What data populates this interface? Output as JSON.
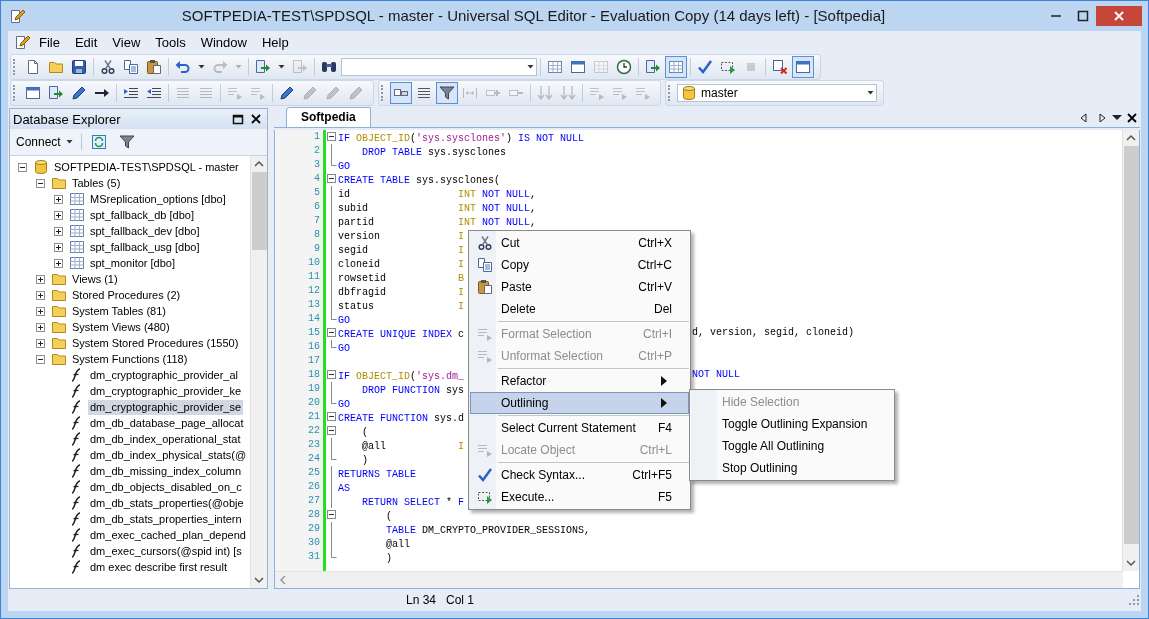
{
  "window": {
    "title": "SOFTPEDIA-TEST\\SPDSQL - master - Universal SQL Editor - Evaluation Copy (14 days left) - [Softpedia]"
  },
  "menu": [
    "File",
    "Edit",
    "View",
    "Tools",
    "Window",
    "Help"
  ],
  "toolbar_rows": [
    [
      {
        "groups": [
          [
            {
              "kind": "button",
              "disabled": false,
              "pressed": false
            },
            {
              "kind": "button",
              "disabled": false,
              "pressed": false
            },
            {
              "kind": "button",
              "disabled": false,
              "pressed": false
            }
          ],
          [
            {
              "kind": "button",
              "disabled": false,
              "pressed": false
            },
            {
              "kind": "button",
              "disabled": false,
              "pressed": false
            },
            {
              "kind": "button",
              "disabled": false,
              "pressed": false
            }
          ],
          [
            {
              "kind": "button",
              "disabled": false,
              "pressed": false
            },
            {
              "kind": "button",
              "disabled": false,
              "pressed": false
            },
            {
              "kind": "button",
              "disabled": true,
              "pressed": false
            },
            {
              "kind": "button",
              "disabled": true,
              "pressed": false
            }
          ],
          [
            {
              "kind": "button",
              "disabled": false,
              "pressed": false
            },
            {
              "kind": "button",
              "disabled": false,
              "pressed": false
            },
            {
              "kind": "button",
              "disabled": true,
              "pressed": false
            }
          ],
          [
            {
              "kind": "button",
              "disabled": false,
              "pressed": false
            },
            {
              "kind": "combo"
            }
          ],
          [
            {
              "kind": "button",
              "disabled": false,
              "pressed": false
            },
            {
              "kind": "button",
              "disabled": false,
              "pressed": false
            },
            {
              "kind": "button",
              "disabled": true,
              "pressed": false
            },
            {
              "kind": "button",
              "disabled": false,
              "pressed": false
            }
          ],
          [
            {
              "kind": "button",
              "disabled": false,
              "pressed": false
            },
            {
              "kind": "button",
              "disabled": false,
              "pressed": true
            }
          ],
          [
            {
              "kind": "button",
              "disabled": false,
              "pressed": false
            },
            {
              "kind": "button",
              "disabled": false,
              "pressed": false
            },
            {
              "kind": "button",
              "disabled": true,
              "pressed": false
            }
          ],
          [
            {
              "kind": "button",
              "disabled": false,
              "pressed": false
            },
            {
              "kind": "button",
              "disabled": false,
              "pressed": true
            }
          ]
        ]
      }
    ],
    [
      {
        "groups": [
          [
            {
              "kind": "button",
              "disabled": false,
              "pressed": false
            },
            {
              "kind": "button",
              "disabled": false,
              "pressed": false
            },
            {
              "kind": "button",
              "disabled": false,
              "pressed": false
            },
            {
              "kind": "button",
              "disabled": false,
              "pressed": false
            }
          ],
          [
            {
              "kind": "button",
              "disabled": false,
              "pressed": false
            },
            {
              "kind": "button",
              "disabled": false,
              "pressed": false
            }
          ],
          [
            {
              "kind": "button",
              "disabled": true,
              "pressed": false
            },
            {
              "kind": "button",
              "disabled": true,
              "pressed": false
            }
          ],
          [
            {
              "kind": "button",
              "disabled": true,
              "pressed": false
            },
            {
              "kind": "button",
              "disabled": true,
              "pressed": false
            }
          ],
          [
            {
              "kind": "button",
              "disabled": false,
              "pressed": false
            },
            {
              "kind": "button",
              "disabled": true,
              "pressed": false
            },
            {
              "kind": "button",
              "disabled": true,
              "pressed": false
            },
            {
              "kind": "button",
              "disabled": true,
              "pressed": false
            }
          ]
        ]
      },
      {
        "groups": [
          [
            {
              "kind": "button",
              "disabled": false,
              "pressed": true
            },
            {
              "kind": "button",
              "disabled": false,
              "pressed": false
            },
            {
              "kind": "button",
              "disabled": false,
              "pressed": true
            },
            {
              "kind": "button",
              "disabled": true,
              "pressed": false
            },
            {
              "kind": "button",
              "disabled": true,
              "pressed": false
            },
            {
              "kind": "button",
              "disabled": true,
              "pressed": false
            }
          ],
          [
            {
              "kind": "button",
              "disabled": true,
              "pressed": false
            },
            {
              "kind": "button",
              "disabled": true,
              "pressed": false
            }
          ],
          [
            {
              "kind": "button",
              "disabled": true,
              "pressed": false
            },
            {
              "kind": "button",
              "disabled": true,
              "pressed": false
            },
            {
              "kind": "button",
              "disabled": true,
              "pressed": false
            }
          ]
        ]
      },
      {
        "groups": [
          [
            {
              "kind": "combo",
              "value": "master"
            }
          ]
        ]
      }
    ]
  ],
  "explorer": {
    "title": "Database Explorer",
    "connect": "Connect",
    "tree": [
      {
        "label": "SOFTPEDIA-TEST\\SPDSQL - master",
        "kind": "database",
        "expanded": true,
        "selected": false,
        "children": [
          {
            "label": "Tables (5)",
            "kind": "folder",
            "expanded": true,
            "selected": false,
            "children": [
              {
                "label": "MSreplication_options [dbo]",
                "kind": "table",
                "expanded": false,
                "selected": false
              },
              {
                "label": "spt_fallback_db [dbo]",
                "kind": "table",
                "expanded": false,
                "selected": false
              },
              {
                "label": "spt_fallback_dev [dbo]",
                "kind": "table",
                "expanded": false,
                "selected": false
              },
              {
                "label": "spt_fallback_usg [dbo]",
                "kind": "table",
                "expanded": false,
                "selected": false
              },
              {
                "label": "spt_monitor [dbo]",
                "kind": "table",
                "expanded": false,
                "selected": false
              }
            ]
          },
          {
            "label": "Views (1)",
            "kind": "folder",
            "expanded": false,
            "selected": false
          },
          {
            "label": "Stored Procedures (2)",
            "kind": "folder",
            "expanded": false,
            "selected": false
          },
          {
            "label": "System Tables (81)",
            "kind": "folder",
            "expanded": false,
            "selected": false
          },
          {
            "label": "System Views (480)",
            "kind": "folder",
            "expanded": false,
            "selected": false
          },
          {
            "label": "System Stored Procedures (1550)",
            "kind": "folder",
            "expanded": false,
            "selected": false
          },
          {
            "label": "System Functions (118)",
            "kind": "folder",
            "expanded": true,
            "selected": false,
            "children": [
              {
                "label": "dm_cryptographic_provider_al",
                "kind": "function",
                "selected": false
              },
              {
                "label": "dm_cryptographic_provider_ke",
                "kind": "function",
                "selected": false
              },
              {
                "label": "dm_cryptographic_provider_se",
                "kind": "function",
                "selected": true
              },
              {
                "label": "dm_db_database_page_allocat",
                "kind": "function",
                "selected": false
              },
              {
                "label": "dm_db_index_operational_stat",
                "kind": "function",
                "selected": false
              },
              {
                "label": "dm_db_index_physical_stats(@",
                "kind": "function",
                "selected": false
              },
              {
                "label": "dm_db_missing_index_column",
                "kind": "function",
                "selected": false
              },
              {
                "label": "dm_db_objects_disabled_on_c",
                "kind": "function",
                "selected": false
              },
              {
                "label": "dm_db_stats_properties(@obje",
                "kind": "function",
                "selected": false
              },
              {
                "label": "dm_db_stats_properties_intern",
                "kind": "function",
                "selected": false
              },
              {
                "label": "dm_exec_cached_plan_depend",
                "kind": "function",
                "selected": false
              },
              {
                "label": "dm_exec_cursors(@spid int) [s",
                "kind": "function",
                "selected": false
              },
              {
                "label": "dm exec describe first result",
                "kind": "function",
                "selected": false
              }
            ]
          }
        ]
      }
    ]
  },
  "editor": {
    "tabs": [
      {
        "label": "Softpedia",
        "selected": true
      }
    ],
    "lines": [
      {
        "n": "1",
        "kind": "start",
        "parts": [
          {
            "kind": "kw",
            "text": "IF "
          },
          {
            "kind": "fn",
            "text": "OBJECT_ID"
          },
          {
            "kind": "plain",
            "text": "("
          },
          {
            "kind": "str",
            "text": "'sys.sysclones'"
          },
          {
            "kind": "plain",
            "text": ") "
          },
          {
            "kind": "kw",
            "text": "IS NOT NULL"
          }
        ]
      },
      {
        "n": "2",
        "kind": "inner",
        "parts": [
          {
            "kind": "kw",
            "text": "    DROP TABLE"
          },
          {
            "kind": "plain",
            "text": " sys.sysclones"
          }
        ]
      },
      {
        "n": "3",
        "kind": "end",
        "parts": [
          {
            "kind": "kw",
            "text": "GO"
          }
        ]
      },
      {
        "n": "4",
        "kind": "start",
        "parts": [
          {
            "kind": "kw",
            "text": "CREATE TABLE"
          },
          {
            "kind": "plain",
            "text": " sys.sysclones("
          }
        ]
      },
      {
        "n": "5",
        "kind": "inner",
        "parts": [
          {
            "kind": "plain",
            "text": "id                  "
          },
          {
            "kind": "fn",
            "text": "INT"
          },
          {
            "kind": "kw",
            "text": " NOT NULL"
          },
          {
            "kind": "plain",
            "text": ","
          }
        ]
      },
      {
        "n": "6",
        "kind": "inner",
        "parts": [
          {
            "kind": "plain",
            "text": "subid               "
          },
          {
            "kind": "fn",
            "text": "INT"
          },
          {
            "kind": "kw",
            "text": " NOT NULL"
          },
          {
            "kind": "plain",
            "text": ","
          }
        ]
      },
      {
        "n": "7",
        "kind": "inner",
        "parts": [
          {
            "kind": "plain",
            "text": "partid              "
          },
          {
            "kind": "fn",
            "text": "INT"
          },
          {
            "kind": "kw",
            "text": " NOT NULL"
          },
          {
            "kind": "plain",
            "text": ","
          }
        ]
      },
      {
        "n": "8",
        "kind": "inner",
        "parts": [
          {
            "kind": "plain",
            "text": "version             "
          },
          {
            "kind": "fn",
            "text": "I"
          }
        ]
      },
      {
        "n": "9",
        "kind": "inner",
        "parts": [
          {
            "kind": "plain",
            "text": "segid               "
          },
          {
            "kind": "fn",
            "text": "I"
          }
        ]
      },
      {
        "n": "10",
        "kind": "inner",
        "parts": [
          {
            "kind": "plain",
            "text": "cloneid             "
          },
          {
            "kind": "fn",
            "text": "I"
          }
        ]
      },
      {
        "n": "11",
        "kind": "inner",
        "parts": [
          {
            "kind": "plain",
            "text": "rowsetid            "
          },
          {
            "kind": "fn",
            "text": "B"
          }
        ]
      },
      {
        "n": "12",
        "kind": "inner",
        "parts": [
          {
            "kind": "plain",
            "text": "dbfragid            "
          },
          {
            "kind": "fn",
            "text": "I"
          }
        ]
      },
      {
        "n": "13",
        "kind": "inner",
        "parts": [
          {
            "kind": "plain",
            "text": "status              "
          },
          {
            "kind": "fn",
            "text": "I"
          }
        ]
      },
      {
        "n": "14",
        "kind": "end",
        "parts": [
          {
            "kind": "kw",
            "text": "GO"
          }
        ]
      },
      {
        "n": "15",
        "kind": "start",
        "parts": [
          {
            "kind": "kw",
            "text": "CREATE UNIQUE INDEX"
          },
          {
            "kind": "plain",
            "text": " c"
          }
        ],
        "tail": [
          {
            "kind": "plain",
            "text": "d, version, segid, cloneid)"
          }
        ]
      },
      {
        "n": "16",
        "kind": "end",
        "parts": [
          {
            "kind": "kw",
            "text": "GO"
          }
        ]
      },
      {
        "n": "17",
        "kind": "none"
      },
      {
        "n": "18",
        "kind": "start",
        "parts": [
          {
            "kind": "kw",
            "text": "IF "
          },
          {
            "kind": "fn",
            "text": "OBJECT_ID"
          },
          {
            "kind": "plain",
            "text": "("
          },
          {
            "kind": "str",
            "text": "'sys.dm_"
          }
        ],
        "tail": [
          {
            "kind": "kw",
            "text": "NOT NULL"
          }
        ]
      },
      {
        "n": "19",
        "kind": "inner",
        "parts": [
          {
            "kind": "kw",
            "text": "    DROP FUNCTION"
          },
          {
            "kind": "plain",
            "text": " sys"
          }
        ]
      },
      {
        "n": "20",
        "kind": "end",
        "parts": [
          {
            "kind": "kw",
            "text": "GO"
          }
        ]
      },
      {
        "n": "21",
        "kind": "start",
        "parts": [
          {
            "kind": "kw",
            "text": "CREATE FUNCTION"
          },
          {
            "kind": "plain",
            "text": " sys.d"
          }
        ]
      },
      {
        "n": "22",
        "kind": "start",
        "parts": [
          {
            "kind": "plain",
            "text": "    ("
          }
        ]
      },
      {
        "n": "23",
        "kind": "inner",
        "parts": [
          {
            "kind": "plain",
            "text": "    @all            "
          },
          {
            "kind": "fn",
            "text": "I"
          }
        ]
      },
      {
        "n": "24",
        "kind": "end",
        "parts": [
          {
            "kind": "plain",
            "text": "    )"
          }
        ]
      },
      {
        "n": "25",
        "kind": "inner",
        "parts": [
          {
            "kind": "kw",
            "text": "RETURNS TABLE"
          }
        ]
      },
      {
        "n": "26",
        "kind": "inner",
        "parts": [
          {
            "kind": "kw",
            "text": "AS"
          }
        ]
      },
      {
        "n": "27",
        "kind": "inner",
        "parts": [
          {
            "kind": "kw",
            "text": "    RETURN SELECT"
          },
          {
            "kind": "plain",
            "text": " * "
          },
          {
            "kind": "kw",
            "text": "F"
          }
        ]
      },
      {
        "n": "28",
        "kind": "start",
        "parts": [
          {
            "kind": "plain",
            "text": "        ("
          }
        ]
      },
      {
        "n": "29",
        "kind": "inner",
        "parts": [
          {
            "kind": "kw",
            "text": "        TABLE"
          },
          {
            "kind": "plain",
            "text": " DM_CRYPTO_PROVIDER_SESSIONS,"
          }
        ]
      },
      {
        "n": "30",
        "kind": "inner",
        "parts": [
          {
            "kind": "plain",
            "text": "        @all"
          }
        ]
      },
      {
        "n": "31",
        "kind": "end",
        "parts": [
          {
            "kind": "plain",
            "text": "        )"
          }
        ]
      }
    ]
  },
  "context_menu": {
    "items": [
      {
        "kind": "command",
        "label": "Cut",
        "shortcut": "Ctrl+X",
        "disabled": false,
        "selected": false
      },
      {
        "kind": "command",
        "label": "Copy",
        "shortcut": "Ctrl+C",
        "disabled": false,
        "selected": false
      },
      {
        "kind": "command",
        "label": "Paste",
        "shortcut": "Ctrl+V",
        "disabled": false,
        "selected": false
      },
      {
        "kind": "command",
        "label": "Delete",
        "shortcut": "Del",
        "disabled": false,
        "selected": false
      },
      {
        "kind": "separator"
      },
      {
        "kind": "command",
        "label": "Format Selection",
        "shortcut": "Ctrl+I",
        "disabled": true,
        "selected": false
      },
      {
        "kind": "command",
        "label": "Unformat Selection",
        "shortcut": "Ctrl+P",
        "disabled": true,
        "selected": false
      },
      {
        "kind": "separator"
      },
      {
        "kind": "submenu",
        "label": "Refactor",
        "disabled": false,
        "selected": false
      },
      {
        "kind": "submenu",
        "label": "Outlining",
        "disabled": false,
        "selected": true
      },
      {
        "kind": "separator"
      },
      {
        "kind": "command",
        "label": "Select Current Statement",
        "shortcut": "F4",
        "disabled": false,
        "selected": false
      },
      {
        "kind": "command",
        "label": "Locate Object",
        "shortcut": "Ctrl+L",
        "disabled": true,
        "selected": false
      },
      {
        "kind": "separator"
      },
      {
        "kind": "command",
        "label": "Check Syntax...",
        "shortcut": "Ctrl+F5",
        "disabled": false,
        "selected": false
      },
      {
        "kind": "command",
        "label": "Execute...",
        "shortcut": "F5",
        "disabled": false,
        "selected": false
      }
    ],
    "submenu": [
      {
        "label": "Hide Selection",
        "disabled": true
      },
      {
        "label": "Toggle Outlining Expansion",
        "disabled": false
      },
      {
        "label": "Toggle All Outlining",
        "disabled": false
      },
      {
        "label": "Stop Outlining",
        "disabled": false
      }
    ]
  },
  "status_bar": {
    "line": "Ln 34",
    "column": "Col 1"
  }
}
